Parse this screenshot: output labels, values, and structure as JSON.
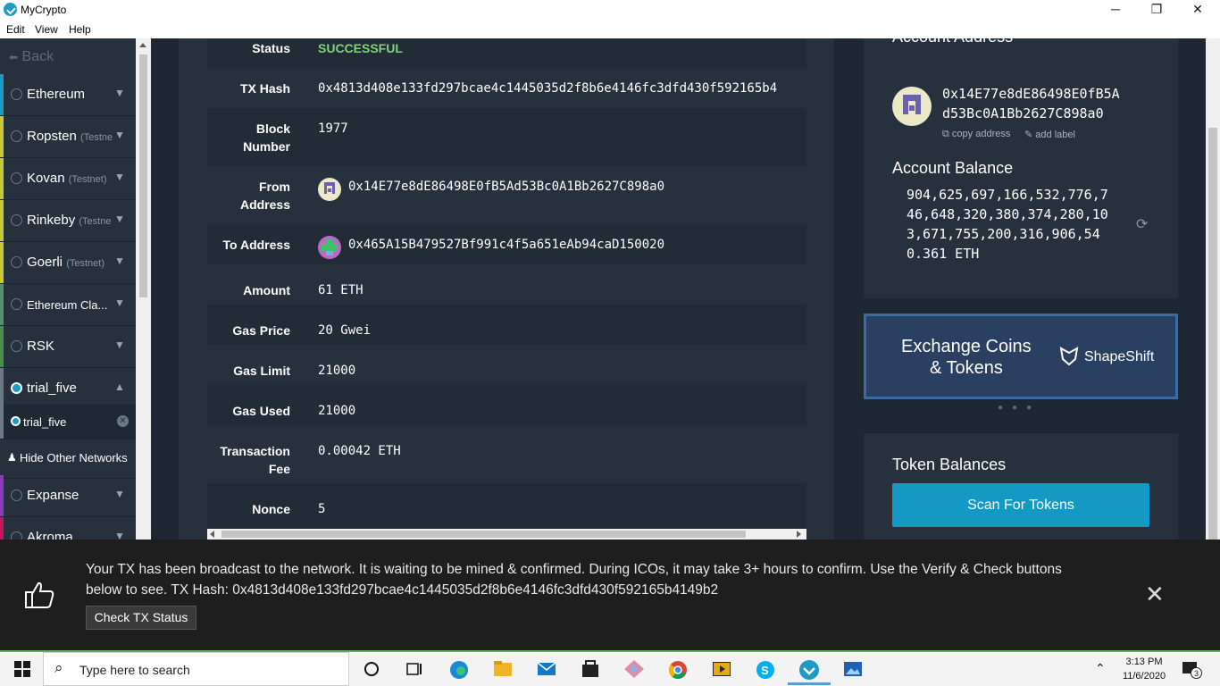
{
  "app": {
    "title": "MyCrypto",
    "menu": [
      "Edit",
      "View",
      "Help"
    ],
    "controls": {
      "minimize": "─",
      "restore": "❐",
      "close": "✕"
    }
  },
  "sidebar": {
    "back_label": "Back",
    "networks": [
      {
        "label": "Ethereum",
        "sub": "",
        "color": "#1d9bc4"
      },
      {
        "label": "Ropsten",
        "sub": "(Testne",
        "color": "#c9c83a"
      },
      {
        "label": "Kovan",
        "sub": "(Testnet)",
        "color": "#c9c83a"
      },
      {
        "label": "Rinkeby",
        "sub": "(Testne",
        "color": "#c9c83a"
      },
      {
        "label": "Goerli",
        "sub": "(Testnet)",
        "color": "#c9c83a"
      },
      {
        "label": "Ethereum Cla...",
        "sub": "",
        "color": "#569070"
      },
      {
        "label": "RSK",
        "sub": "",
        "color": "#4a8d4a"
      },
      {
        "label": "trial_five",
        "sub": "",
        "color": "#6b7886"
      }
    ],
    "active_node": "trial_five",
    "hide_other_label": "Hide Other Networks",
    "networks_below": [
      {
        "label": "Expanse",
        "color": "#8a3ab9"
      },
      {
        "label": "Akroma",
        "color": "#c2185b"
      }
    ]
  },
  "tx": {
    "rows": [
      {
        "label": "Status",
        "value": "SUCCESSFUL"
      },
      {
        "label": "TX Hash",
        "value": "0x4813d408e133fd297bcae4c1445035d2f8b6e4146fc3dfd430f592165b4"
      },
      {
        "label": "Block Number",
        "value": "1977"
      },
      {
        "label": "From Address",
        "value": "0x14E77e8dE86498E0fB5Ad53Bc0A1Bb2627C898a0"
      },
      {
        "label": "To Address",
        "value": "0x465A15B479527Bf991c4f5a651eAb94caD150020"
      },
      {
        "label": "Amount",
        "value": "61 ETH"
      },
      {
        "label": "Gas Price",
        "value": "20 Gwei"
      },
      {
        "label": "Gas Limit",
        "value": "21000"
      },
      {
        "label": "Gas Used",
        "value": "21000"
      },
      {
        "label": "Transaction Fee",
        "value": "0.00042 ETH"
      },
      {
        "label": "Nonce",
        "value": "5"
      }
    ]
  },
  "account": {
    "heading": "Account Address",
    "address_line1": "0x14E77e8dE86498E0fB5A",
    "address_line2": "d53Bc0A1Bb2627C898a0",
    "copy_label": "copy address",
    "add_label": "add label",
    "balance_heading": "Account Balance",
    "balance_lines": [
      "904,625,697,166,532,776,7",
      "46,648,320,380,374,280,10",
      "3,671,755,200,316,906,54",
      "0.361 ETH"
    ]
  },
  "shapeshift": {
    "line1": "Exchange Coins",
    "line2": "& Tokens",
    "brand": "ShapeShift"
  },
  "tokens": {
    "heading": "Token Balances",
    "scan_label": "Scan For Tokens"
  },
  "notification": {
    "message": "Your TX has been broadcast to the network. It is waiting to be mined & confirmed. During ICOs, it may take 3+ hours to confirm. Use the Verify & Check buttons below to see. TX Hash: 0x4813d408e133fd297bcae4c1445035d2f8b6e4146fc3dfd430f592165b4149b2",
    "button_label": "Check TX Status"
  },
  "taskbar": {
    "search_placeholder": "Type here to search",
    "time": "3:13 PM",
    "date": "11/6/2020",
    "notif_count": "3"
  }
}
